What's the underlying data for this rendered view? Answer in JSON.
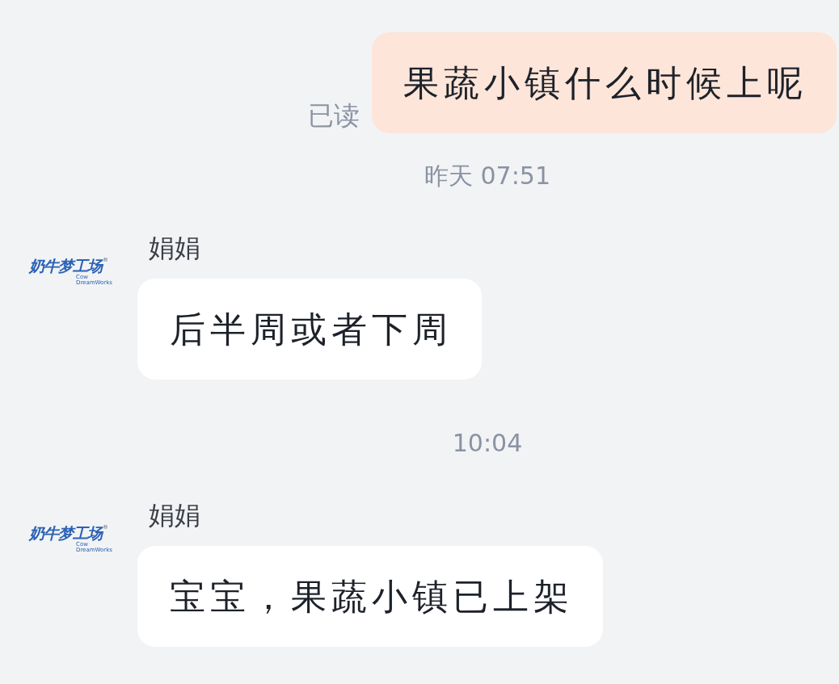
{
  "messages": [
    {
      "kind": "outgoing",
      "text": "果蔬小镇什么时候上呢",
      "read_receipt": "已读"
    },
    {
      "kind": "timestamp",
      "text": "昨天 07:51"
    },
    {
      "kind": "incoming",
      "sender": "娟娟",
      "avatar": {
        "wordmark": "奶牛梦工场",
        "registered_mark": "®",
        "tagline": [
          "Cow",
          "DreamWorks"
        ]
      },
      "text": "后半周或者下周"
    },
    {
      "kind": "timestamp",
      "text": "10:04"
    },
    {
      "kind": "incoming",
      "sender": "娟娟",
      "avatar": {
        "wordmark": "奶牛梦工场",
        "registered_mark": "®",
        "tagline": [
          "Cow",
          "DreamWorks"
        ]
      },
      "text": "宝宝，果蔬小镇已上架"
    }
  ]
}
